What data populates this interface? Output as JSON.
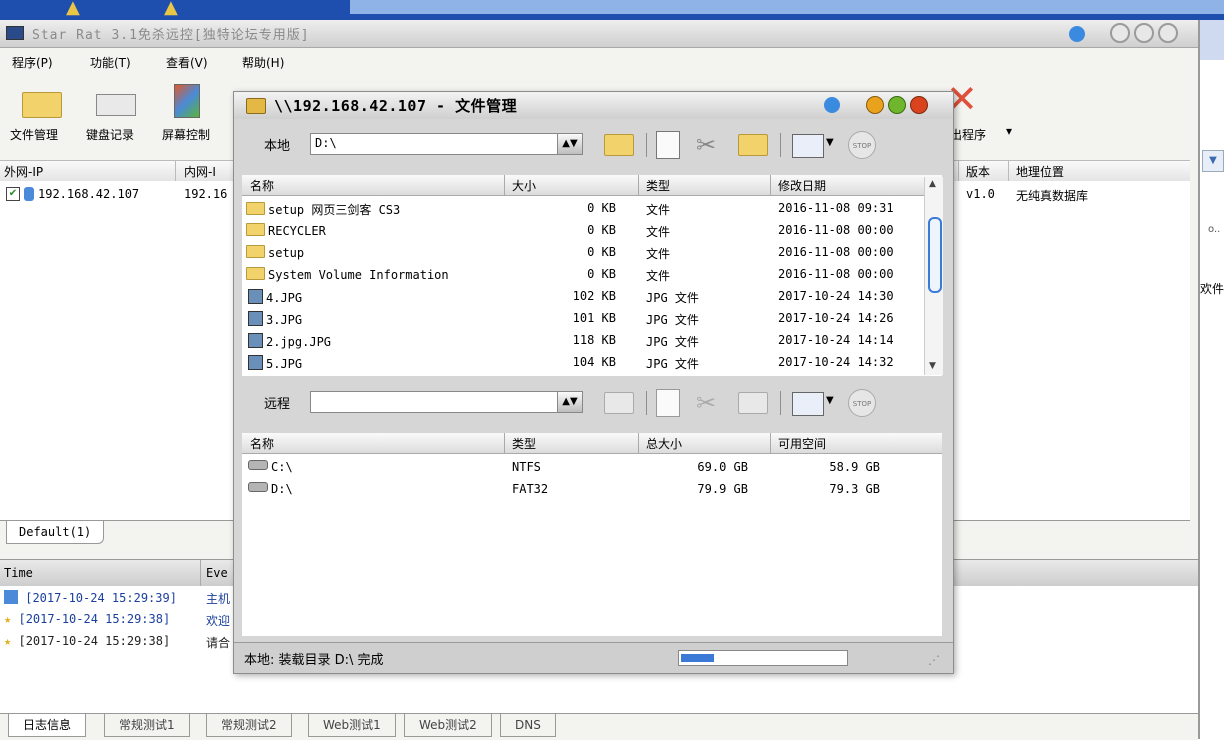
{
  "main": {
    "title": "Star Rat 3.1免杀远控[独特论坛专用版]",
    "menu": [
      "程序(P)",
      "功能(T)",
      "查看(V)",
      "帮助(H)"
    ],
    "toolbar": [
      "文件管理",
      "键盘记录",
      "屏幕控制",
      "出程序"
    ],
    "list_columns": [
      "外网-IP",
      "内网-I",
      "版本",
      "地理位置"
    ],
    "client": {
      "wan_ip": "192.168.42.107",
      "lan_ip": "192.16",
      "version": "v1.0",
      "location": "无纯真数据库"
    },
    "group_tab": "Default(1)",
    "log_columns": [
      "Time",
      "Eve"
    ],
    "log_rows": [
      {
        "time": "[2017-10-24 15:29:39]",
        "event": "主机"
      },
      {
        "time": "[2017-10-24 15:29:38]",
        "event": "欢迎"
      },
      {
        "time": "[2017-10-24 15:29:38]",
        "event": "请合"
      }
    ],
    "bottom_tabs": [
      "日志信息",
      "常规测试1",
      "常规测试2",
      "Web测试1",
      "Web测试2",
      "DNS"
    ],
    "side_text": [
      "o..",
      "欢件"
    ]
  },
  "dialog": {
    "title": "\\\\192.168.42.107 - 文件管理",
    "local_label": "本地",
    "local_path": "D:\\",
    "remote_label": "远程",
    "remote_path": "",
    "local_columns": [
      "名称",
      "大小",
      "类型",
      "修改日期"
    ],
    "local_files": [
      {
        "name": "setup 网页三剑客 CS3",
        "size": "0 KB",
        "type": "文件",
        "date": "2016-11-08 09:31",
        "kind": "folder"
      },
      {
        "name": "RECYCLER",
        "size": "0 KB",
        "type": "文件",
        "date": "2016-11-08 00:00",
        "kind": "folder"
      },
      {
        "name": "setup",
        "size": "0 KB",
        "type": "文件",
        "date": "2016-11-08 00:00",
        "kind": "folder"
      },
      {
        "name": "System Volume Information",
        "size": "0 KB",
        "type": "文件",
        "date": "2016-11-08 00:00",
        "kind": "folder"
      },
      {
        "name": "4.JPG",
        "size": "102 KB",
        "type": "JPG 文件",
        "date": "2017-10-24 14:30",
        "kind": "jpg"
      },
      {
        "name": "3.JPG",
        "size": "101 KB",
        "type": "JPG 文件",
        "date": "2017-10-24 14:26",
        "kind": "jpg"
      },
      {
        "name": "2.jpg.JPG",
        "size": "118 KB",
        "type": "JPG 文件",
        "date": "2017-10-24 14:14",
        "kind": "jpg"
      },
      {
        "name": "5.JPG",
        "size": "104 KB",
        "type": "JPG 文件",
        "date": "2017-10-24 14:32",
        "kind": "jpg"
      }
    ],
    "remote_columns": [
      "名称",
      "类型",
      "总大小",
      "可用空间"
    ],
    "drives": [
      {
        "name": "C:\\",
        "type": "NTFS",
        "total": "69.0 GB",
        "free": "58.9 GB"
      },
      {
        "name": "D:\\",
        "type": "FAT32",
        "total": "79.9 GB",
        "free": "79.3 GB"
      }
    ],
    "status": "本地: 装载目录 D:\\ 完成",
    "stop_label": "STOP",
    "progress": 0.2
  },
  "colors": {
    "accent": "#3a79d6",
    "close": "#d9431e",
    "minimize": "#e8a21c",
    "maximize": "#6fb52d"
  }
}
